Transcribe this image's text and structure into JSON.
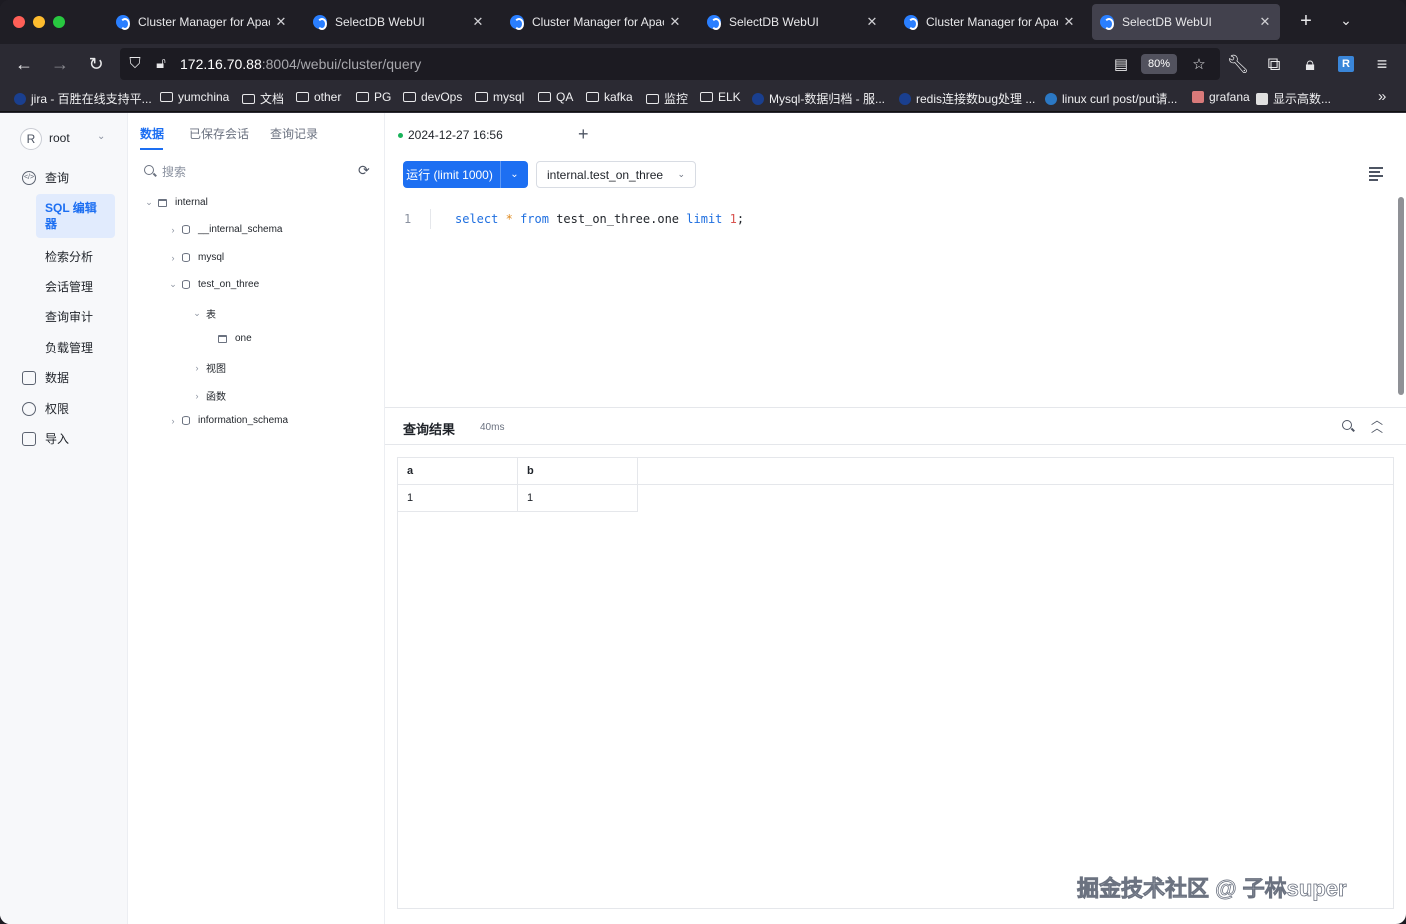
{
  "browser": {
    "tabs": [
      {
        "title": "Cluster Manager for Apache Doris",
        "active": false
      },
      {
        "title": "SelectDB WebUI",
        "active": false
      },
      {
        "title": "Cluster Manager for Apache Doris",
        "active": false
      },
      {
        "title": "SelectDB WebUI",
        "active": false
      },
      {
        "title": "Cluster Manager for Apache Doris",
        "active": false
      },
      {
        "title": "SelectDB WebUI",
        "active": true
      }
    ],
    "url_host": "172.16.70.88",
    "url_rest": ":8004/webui/cluster/query",
    "zoom": "80%",
    "ext_badge": "R",
    "bookmarks": [
      "jira - 百胜在线支持平...",
      "yumchina",
      "文档",
      "other",
      "PG",
      "devOps",
      "mysql",
      "QA",
      "kafka",
      "监控",
      "ELK",
      "Mysql-数据归档 - 服...",
      "redis连接数bug处理 ...",
      "linux curl post/put请...",
      "grafana",
      "显示高数..."
    ]
  },
  "sidebar": {
    "avatar": "R",
    "user": "root",
    "nav": {
      "query": "查询",
      "sql_editor": "SQL 编辑器",
      "search_analysis": "检索分析",
      "session_mgmt": "会话管理",
      "query_audit": "查询审计",
      "workload_mgmt": "负载管理",
      "data": "数据",
      "permission": "权限",
      "import": "导入"
    }
  },
  "schema_panel": {
    "tabs": [
      "数据",
      "已保存会话",
      "查询记录"
    ],
    "search_placeholder": "搜索",
    "tree": {
      "catalog": "internal",
      "db1": "__internal_schema",
      "db2": "mysql",
      "db3": "test_on_three",
      "group_tables": "表",
      "table1": "one",
      "group_views": "视图",
      "group_functions": "函数",
      "db4": "information_schema"
    }
  },
  "editor": {
    "tab_label": "2024-12-27 16:56",
    "run_button": "运行 (limit 1000)",
    "database_select": "internal.test_on_three",
    "line_number": "1",
    "code": {
      "k1": "select",
      "star": "*",
      "k2": "from",
      "ident": "test_on_three.one",
      "k3": "limit",
      "num": "1",
      "end": ";"
    }
  },
  "results": {
    "title": "查询结果",
    "time": "40ms",
    "columns": [
      "a",
      "b"
    ],
    "rows": [
      [
        "1",
        "1"
      ]
    ]
  },
  "watermark": "掘金技术社区 @ 子林super",
  "colors": {
    "accent": "#1d6ff2",
    "sidebar_active_bg": "#e1ebfd",
    "status_green": "#19b35a"
  }
}
